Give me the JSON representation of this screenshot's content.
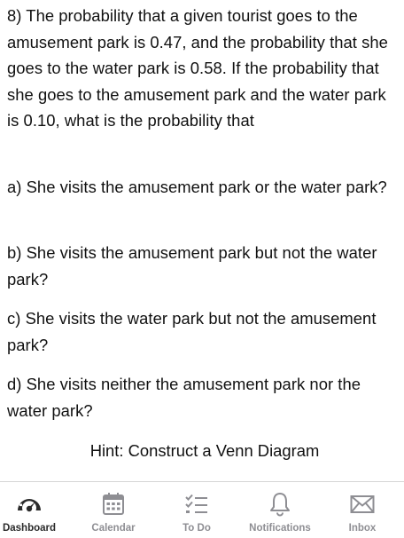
{
  "question": {
    "text": "8)  The probability that a given tourist goes to the amusement park is 0.47, and the probability that she goes to the water park is 0.58.  If the probability that she goes to the amusement park and the water park is 0.10, what is the probability that"
  },
  "parts": {
    "a": "a) She visits the amusement park or the water park?",
    "b": "b) She visits the amusement park but not the water park?",
    "c": "c) She visits the water park but not the amusement park?",
    "d": "d) She visits neither the amusement park nor the water park?"
  },
  "hint": "Hint:  Construct a Venn Diagram",
  "tabbar": {
    "active_color": "#2b2b2b",
    "inactive_color": "#8e8e93",
    "items": [
      {
        "label": "Dashboard",
        "icon": "dashboard-gauge-icon",
        "active": true
      },
      {
        "label": "Calendar",
        "icon": "calendar-icon",
        "active": false
      },
      {
        "label": "To Do",
        "icon": "todo-list-icon",
        "active": false
      },
      {
        "label": "Notifications",
        "icon": "bell-icon",
        "active": false
      },
      {
        "label": "Inbox",
        "icon": "envelope-icon",
        "active": false
      }
    ]
  }
}
